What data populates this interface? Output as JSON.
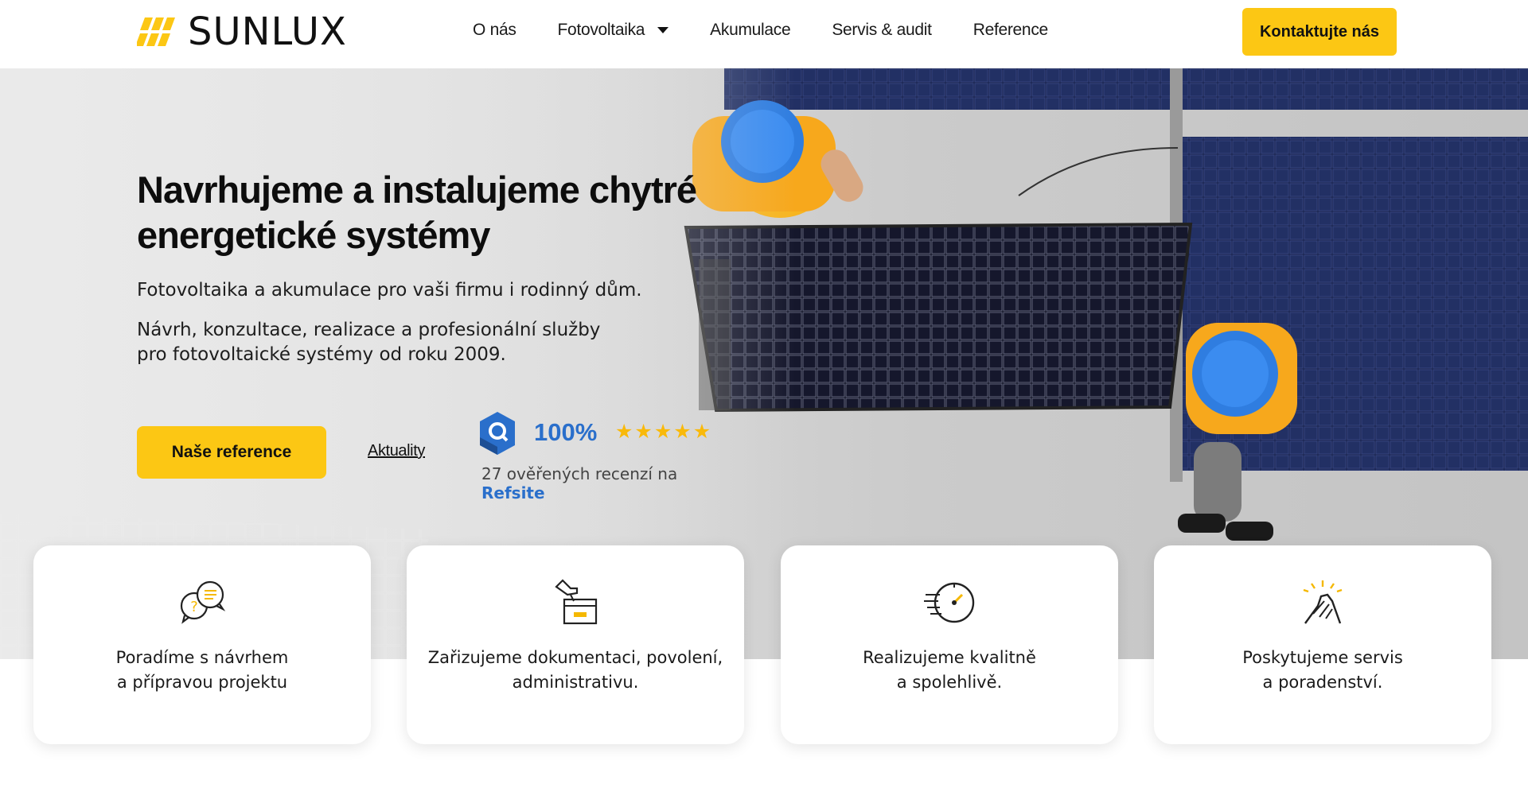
{
  "brand": {
    "name": "SUNLUX",
    "accent": "#fcc714"
  },
  "nav": {
    "items": [
      {
        "label": "O nás"
      },
      {
        "label": "Fotovoltaika",
        "has_dropdown": true
      },
      {
        "label": "Akumulace"
      },
      {
        "label": "Servis & audit"
      },
      {
        "label": "Reference"
      }
    ],
    "cta_label": "Kontaktujte nás"
  },
  "hero": {
    "title": "Navrhujeme a instalujeme chytré energetické systémy",
    "subtitle": "Fotovoltaika a akumulace pro vaši firmu i rodinný dům.",
    "description": "Návrh, konzultace, realizace a profesionální služby pro fotovoltaické systémy od roku 2009.",
    "primary_button": "Naše reference",
    "secondary_link": "Aktuality"
  },
  "rating": {
    "score": "100%",
    "stars": 5,
    "text_prefix": "27 ověřených recenzí na",
    "source": "Refsite",
    "color": "#2a6fcb"
  },
  "features": [
    {
      "icon": "chat-question-icon",
      "text": "Poradíme s návrhem\na přípravou projektu"
    },
    {
      "icon": "document-hand-icon",
      "text": "Zařizujeme dokumentaci, povolení,\nadministrativu."
    },
    {
      "icon": "speed-clock-icon",
      "text": "Realizujeme kvalitně\na spolehlivě."
    },
    {
      "icon": "handshake-icon",
      "text": "Poskytujeme servis\na poradenství."
    }
  ]
}
